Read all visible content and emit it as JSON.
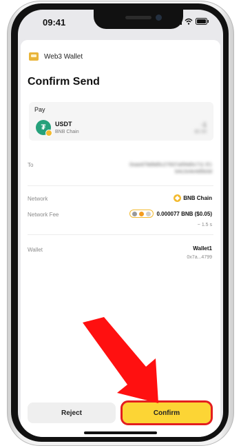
{
  "status_bar": {
    "time": "09:41"
  },
  "header": {
    "title": "Web3 Wallet"
  },
  "page_title": "Confirm Send",
  "pay": {
    "label": "Pay",
    "token": "USDT",
    "chain": "BNB Chain",
    "amount": "-1",
    "amount_fiat": "$0.99"
  },
  "to": {
    "label": "To",
    "address": "0xaed79d9d5c27837a5f4d0c711 E1 b4c2e4e4d5b3d"
  },
  "network": {
    "label": "Network",
    "value": "BNB Chain"
  },
  "fee": {
    "label": "Network Fee",
    "value": "0.000077 BNB ($0.05)",
    "time": "~ 1.5 s"
  },
  "wallet": {
    "label": "Wallet",
    "name": "Wallet1",
    "address": "0x7a...4799"
  },
  "buttons": {
    "reject": "Reject",
    "confirm": "Confirm"
  },
  "colors": {
    "accent": "#FCD535",
    "highlight": "#E41E1E",
    "usdt": "#26A17B",
    "bnb": "#F3BA2F"
  }
}
